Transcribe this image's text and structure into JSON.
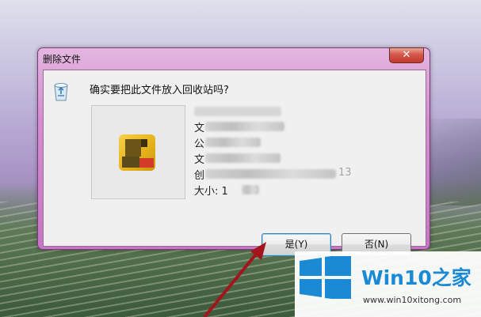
{
  "dialog": {
    "title": "删除文件",
    "close_symbol": "✕",
    "question": "确实要把此文件放入回收站吗?",
    "details": {
      "row1_label": "文",
      "row2_label": "公",
      "row3_label": "文",
      "row4_label": "创",
      "row4_tail": "13",
      "row5_label": "大小: 1"
    },
    "buttons": {
      "yes": "是(Y)",
      "no": "否(N)"
    }
  },
  "watermark": {
    "brand_main": "Win10",
    "brand_suffix": "之家",
    "site": "www.win10xitong.com"
  },
  "colors": {
    "frame": "#d58fd1",
    "arrow": "#a3151c",
    "brand": "#1a8ad4"
  }
}
